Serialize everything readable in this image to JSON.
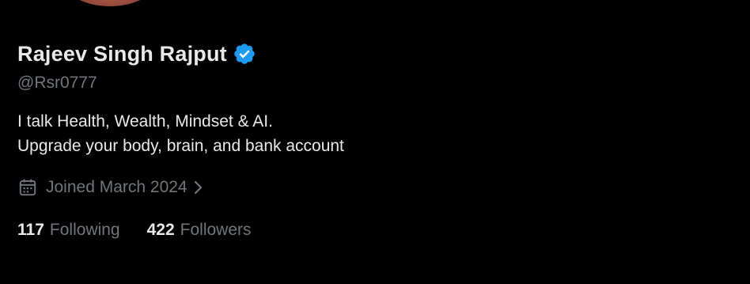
{
  "profile": {
    "display_name": "Rajeev Singh Rajput",
    "verified_badge_icon": "verified-badge-icon",
    "handle": "@Rsr0777",
    "bio_lines": [
      "I talk Health, Wealth, Mindset & AI.",
      "Upgrade your body, brain, and bank account"
    ],
    "joined_icon": "calendar-icon",
    "joined_text": "Joined March 2024",
    "joined_chevron_icon": "chevron-right-icon",
    "following_count": "117",
    "following_label": "Following",
    "followers_count": "422",
    "followers_label": "Followers"
  },
  "colors": {
    "background": "#000000",
    "primary_text": "#e7e9ea",
    "secondary_text": "#71767b",
    "verified_blue": "#1d9bf0"
  }
}
